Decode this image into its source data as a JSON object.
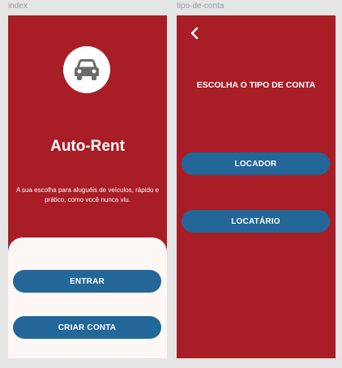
{
  "canvas": {
    "frames": [
      {
        "label": "index",
        "logo_icon": "car-icon",
        "title": "Auto-Rent",
        "tagline": "A sua escolha para aluguéis de veículos, rápido e prático, como você nunca viu.",
        "buttons": {
          "login": "ENTRAR",
          "signup": "CRIAR CONTA"
        }
      },
      {
        "label": "tipo-de-conta",
        "back_icon": "chevron-left-icon",
        "title": "ESCOLHA O TIPO DE CONTA",
        "buttons": {
          "landlord": "LOCADOR",
          "tenant": "LOCATÁRIO"
        }
      }
    ]
  },
  "colors": {
    "canvas_background": "#e5e5e5",
    "brand_red": "#a81d26",
    "button_blue": "#236799",
    "panel_white": "#fdf7f6",
    "icon_gray": "#6b6b6b"
  }
}
